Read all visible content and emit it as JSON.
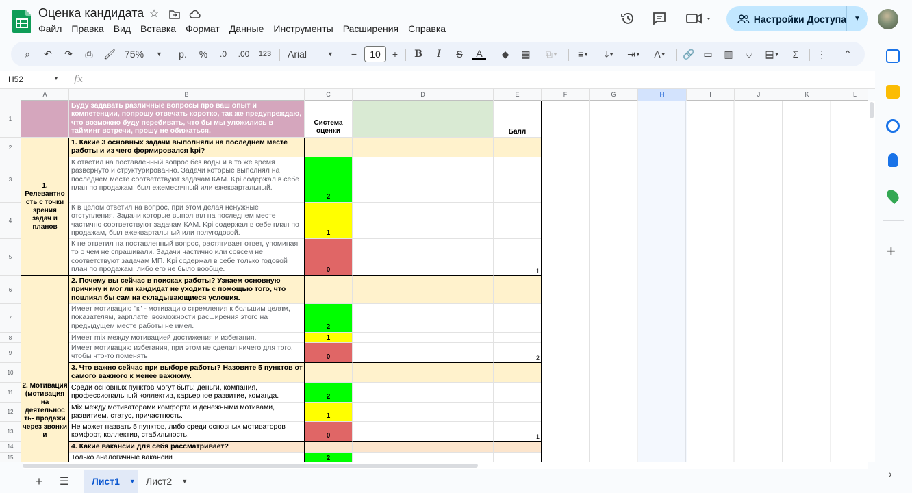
{
  "header": {
    "title": "Оценка кандидата",
    "menus": [
      "Файл",
      "Правка",
      "Вид",
      "Вставка",
      "Формат",
      "Данные",
      "Инструменты",
      "Расширения",
      "Справка"
    ],
    "share_label": "Настройки Доступа"
  },
  "toolbar": {
    "zoom": "75%",
    "currency": "р.",
    "percent": "%",
    "dec_minus": ".0",
    "dec_plus": ".00",
    "number_format": "123",
    "font": "Arial",
    "font_size": "10"
  },
  "formula_bar": {
    "cell_ref": "H52",
    "fx": "fx"
  },
  "columns": [
    "A",
    "B",
    "C",
    "D",
    "E",
    "F",
    "G",
    "H",
    "I",
    "J",
    "K",
    "L"
  ],
  "rows": [
    "1",
    "2",
    "3",
    "4",
    "5",
    "6",
    "7",
    "8",
    "9",
    "10",
    "11",
    "12",
    "13",
    "14",
    "15"
  ],
  "cells": {
    "b1": "Буду задавать различные вопросы про ваш опыт и компетенции, попрошу отвечать коротко, так же предупреждаю, что возможно буду перебивать, что бы мы уложились в тайминг встречи, прошу не обижаться.",
    "c1": "Система оценки",
    "e1": "Балл",
    "a_block1": "1. Релевантно сть с точки зрения задач и планов",
    "b2": "1. Какие 3 основных задачи выполняли на последнем месте работы и из чего формировался kpi?",
    "b3": "К ответил на поставленный вопрос без воды и в то же время развернуто и структурированно. Задачи которые выполнял на последнем месте соответствуют задачам КАМ. Kpi содержал в себе план по продажам, был ежемесячный или ежеквартальный.",
    "c3": "2",
    "b4": "К в целом ответил на вопрос, при этом делая ненужные отступления. Задачи которые выполнял на последнем месте частично соответствуют задачам КАМ. Kpi содержал в себе план по продажам, был ежеквартальный или полугодовой.",
    "c4": "1",
    "b5": "К не ответил на поставленный вопрос, растягивает ответ, упоминая то о чем не спрашивали. Задачи частично или совсем не соответствуют задачам МП. Kpi содержал в себе только годовой план по продажам, либо его не было вообще.",
    "c5": "0",
    "e5": "1",
    "a_block2": "2. Мотивация (мотивация на деятельнос ть- продажи через звонки и",
    "b6": "2. Почему вы сейчас в поисках работы? Узнаем основную причину и мог ли кандидат не уходить с помощью того, что повлиял бы сам на складывающиеся условия.",
    "b7": "Имеет мотивацию \"к\" - мотивацию стремления к большим целям, показателям, зарплате, возможности расширения этого на предыдущем месте работы не имел.",
    "c7": "2",
    "b8": "Имеет mix между мотивацией достижения и избегания.",
    "c8": "1",
    "b9": "Имеет мотивацию избегания, при этом не сделал ничего для того, чтобы что-то поменять",
    "c9": "0",
    "e9": "2",
    "b10": "3. Что важно сейчас при выборе работы? Назовите 5 пунктов от самого важного к менее важному.",
    "b11": "Среди основных пунктов могут быть: деньги, компания, профессиональный коллектив, карьерное развитие, команда.",
    "c11": "2",
    "b12": "Mix между мотиваторами комфорта и денежными мотивами, развитием, статус, причастность.",
    "c12": "1",
    "b13": "Не может назвать 5 пунктов, либо среди основных мотиваторов комфорт, коллектив, стабильность.",
    "c13": "0",
    "e13": "1",
    "b14": "4. Какие вакансии для себя рассматривает?",
    "b15": "Только аналогичные вакансии",
    "c15": "2"
  },
  "tabs": [
    "Лист1",
    "Лист2"
  ],
  "colors": {
    "pink": "#d5a6bd",
    "yellow_light": "#fff2cc",
    "light_yellow2": "#fce5cd",
    "green_light": "#d9ead3",
    "green": "#00ff00",
    "yellow": "#ffff00",
    "red": "#e06666",
    "selected_col": "#d3e3fd"
  }
}
